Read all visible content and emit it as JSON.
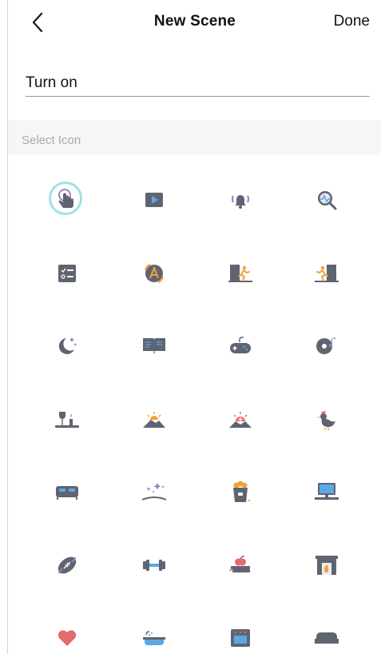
{
  "header": {
    "title": "New Scene",
    "done_label": "Done",
    "back_icon": "chevron-left-icon"
  },
  "scene_name": {
    "value": "Turn on",
    "placeholder": ""
  },
  "icon_section": {
    "label": "Select Icon",
    "selected_index": 0,
    "icons": [
      "hand-tap-icon",
      "play-icon",
      "bell-ringing-icon",
      "search-activity-icon",
      "checklist-icon",
      "auto-mode-icon",
      "leave-home-icon",
      "arrive-home-icon",
      "moon-stars-icon",
      "open-book-icon",
      "gamepad-icon",
      "music-disc-icon",
      "candle-dinner-icon",
      "sunrise-icon",
      "sunset-icon",
      "chicken-icon",
      "bed-icon",
      "starry-night-icon",
      "popcorn-icon",
      "laptop-desk-icon",
      "football-icon",
      "dumbbell-icon",
      "apple-books-icon",
      "fireplace-icon",
      "heart-icon",
      "bathtub-icon",
      "oven-icon",
      "sofa-icon"
    ]
  },
  "colors": {
    "accent_ring": "#9fe3e3",
    "icon_gray": "#5f6470",
    "icon_blue": "#5aa8e6",
    "icon_purple": "#8e7ccf",
    "icon_orange": "#f0a23a",
    "icon_red": "#e26b6b"
  }
}
